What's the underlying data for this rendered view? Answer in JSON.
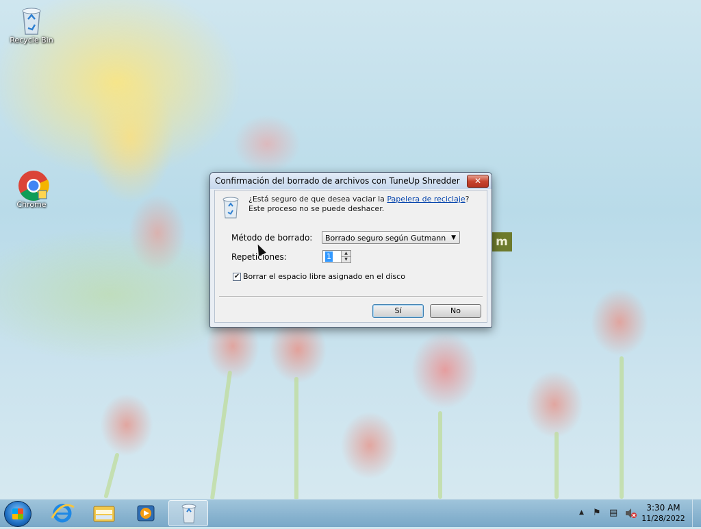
{
  "desktop": {
    "icons": [
      {
        "label": "Recycle Bin",
        "icon": "recycle-bin-icon"
      },
      {
        "label": "Chrome",
        "icon": "chrome-icon"
      }
    ]
  },
  "dialog": {
    "title": "Confirmación del borrado de archivos con TuneUp Shredder",
    "close_label": "✕",
    "message_before": "¿Está seguro de que desea vaciar la ",
    "message_link": "Papelera de reciclaje",
    "message_after": "? Este proceso no se puede deshacer.",
    "method_label": "Método de borrado:",
    "method_value": "Borrado seguro según Gutmann",
    "repetitions_label": "Repeticiones:",
    "repetitions_value": "1",
    "checkbox_label": "Borrar el espacio libre asignado en el disco",
    "checkbox_checked": true,
    "yes_label": "Sí",
    "no_label": "No"
  },
  "taskbar": {
    "pinned": [
      "internet-explorer-icon",
      "file-explorer-icon",
      "media-player-icon",
      "shredder-icon"
    ],
    "clock_time": "3:30 AM",
    "clock_date": "11/28/2022",
    "tray_icons": [
      "show-hidden-icons",
      "action-center-flag-icon",
      "network-icon",
      "volume-muted-icon"
    ]
  },
  "colors": {
    "link": "#0645ad",
    "close_button": "#c8452f",
    "selection": "#3399ff"
  }
}
